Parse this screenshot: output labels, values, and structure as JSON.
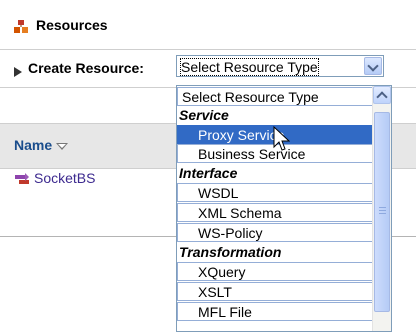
{
  "header": {
    "title": "Resources",
    "icon": "resources-icon"
  },
  "create": {
    "label": "Create Resource:",
    "select_value": "Select Resource Type"
  },
  "table": {
    "name_header": "Name",
    "rows": [
      {
        "name": "SocketBS"
      }
    ]
  },
  "dropdown": {
    "first": "Select Resource Type",
    "groups": [
      {
        "label": "Service",
        "items": [
          "Proxy Service",
          "Business Service"
        ]
      },
      {
        "label": "Interface",
        "items": [
          "WSDL",
          "XML Schema",
          "WS-Policy"
        ]
      },
      {
        "label": "Transformation",
        "items": [
          "XQuery",
          "XSLT",
          "MFL File"
        ]
      }
    ],
    "selected": "Proxy Service"
  },
  "colors": {
    "selection": "#316ac5",
    "link": "#3d2a8f",
    "header_link": "#1a4d8c",
    "band": "#e7e7e7"
  }
}
